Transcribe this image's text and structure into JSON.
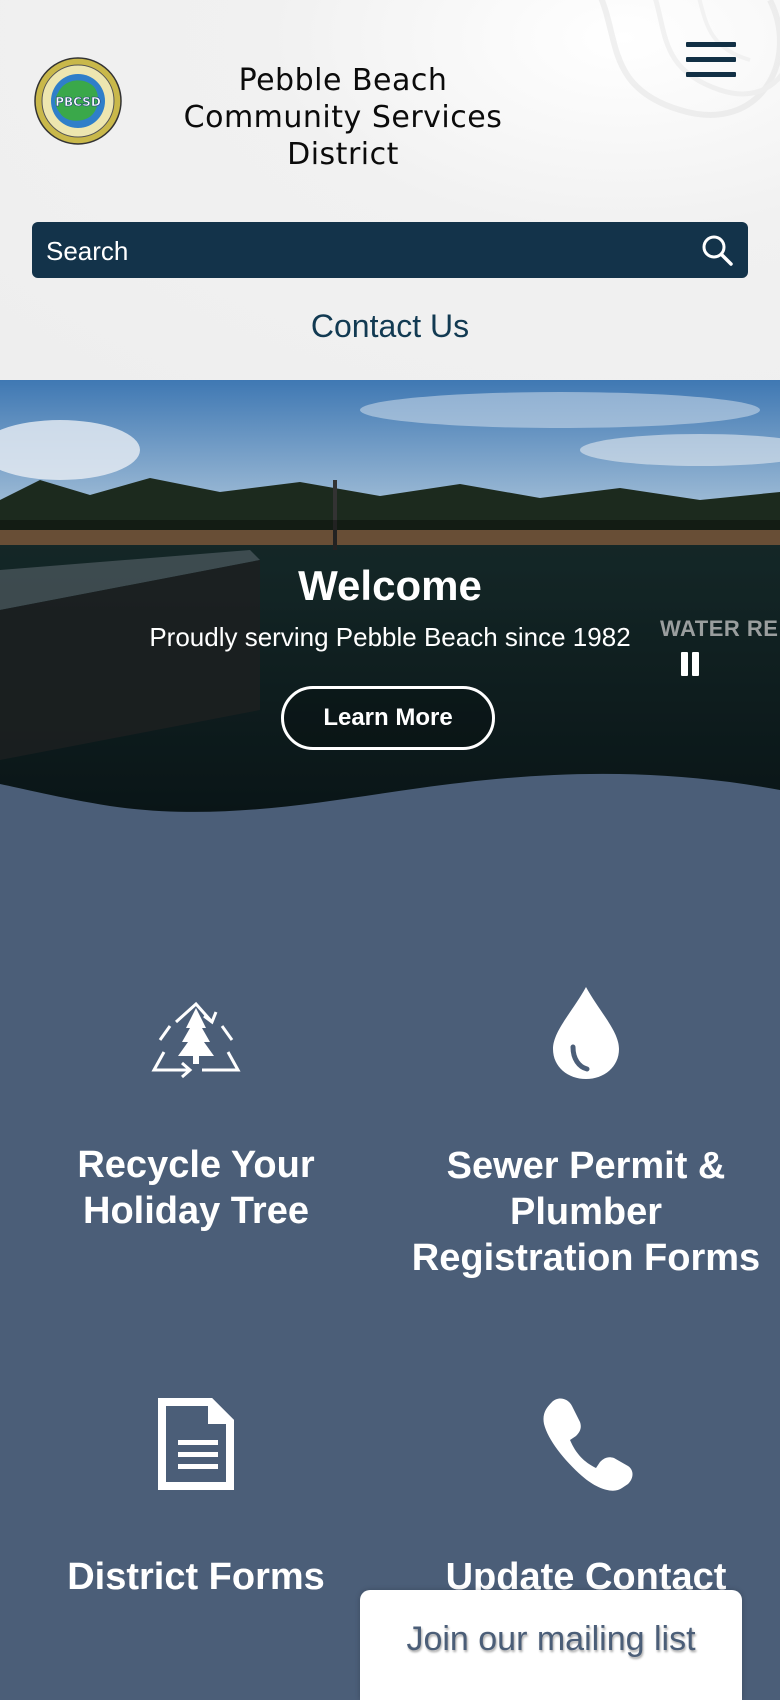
{
  "header": {
    "logo_text": "PBCSD",
    "logo_ring_text": "PEBBLE BEACH COMMUNITY SERVICES DISTRICT",
    "title_line1": "Pebble Beach",
    "title_line2": "Community Services District",
    "menu_icon": "hamburger-menu-icon"
  },
  "search": {
    "placeholder": "Search",
    "icon": "search-icon"
  },
  "nav": {
    "contact_label": "Contact Us"
  },
  "hero": {
    "title": "Welcome",
    "subtitle": "Proudly serving Pebble Beach since 1982",
    "button_label": "Learn More",
    "next_slide_peek": "WATER RE",
    "pause_icon": "pause-icon"
  },
  "services": [
    {
      "label": "Recycle Your Holiday Tree",
      "icon": "recycle-tree-icon"
    },
    {
      "label": "Sewer Permit & Plumber Registration Forms",
      "icon": "water-drop-icon"
    },
    {
      "label": "District Forms",
      "icon": "document-icon"
    },
    {
      "label": "Update Contact",
      "icon": "phone-icon"
    }
  ],
  "mailing": {
    "label": "Join our mailing list"
  },
  "colors": {
    "header_bg": "#eeeeee",
    "search_bg": "#13334a",
    "content_bg": "#4b5e78",
    "accent_text": "#123a52"
  }
}
